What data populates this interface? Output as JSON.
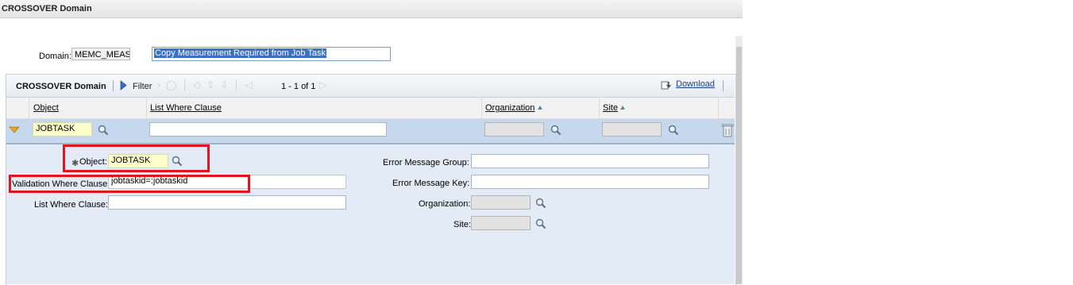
{
  "app": {
    "title": "CROSSOVER Domain"
  },
  "domain": {
    "label": "Domain:",
    "value": "MEMC_MEAS",
    "description": "Copy Measurement Required from Job Task"
  },
  "section": {
    "title": "CROSSOVER Domain",
    "filter_label": "Filter",
    "pagination": "1 - 1 of 1",
    "download_label": "Download"
  },
  "table": {
    "columns": [
      "Object",
      "List Where Clause",
      "Organization",
      "Site"
    ],
    "rows": [
      {
        "object": "JOBTASK",
        "list_where_clause": "",
        "organization": "",
        "site": ""
      }
    ]
  },
  "detail": {
    "object_label": "Object:",
    "object_value": "JOBTASK",
    "validation_label": "Validation Where Clause:",
    "validation_value": "jobtaskid=:jobtaskid",
    "list_where_label": "List Where Clause:",
    "list_where_value": "",
    "error_group_label": "Error Message Group:",
    "error_group_value": "",
    "error_key_label": "Error Message Key:",
    "error_key_value": "",
    "organization_label": "Organization:",
    "organization_value": "",
    "site_label": "Site:",
    "site_value": ""
  },
  "colors": {
    "row_selected": "#c5d8ee",
    "detail_bg": "#e3ecf6",
    "highlight_box": "#e0151f",
    "required_field": "#ffffcc"
  },
  "icons": [
    "magnifier-icon",
    "filter-triangle-icon",
    "download-icon",
    "delete-trash-icon",
    "row-collapse-triangle-icon",
    "sort-arrow-icon",
    "required-asterisk-icon"
  ]
}
